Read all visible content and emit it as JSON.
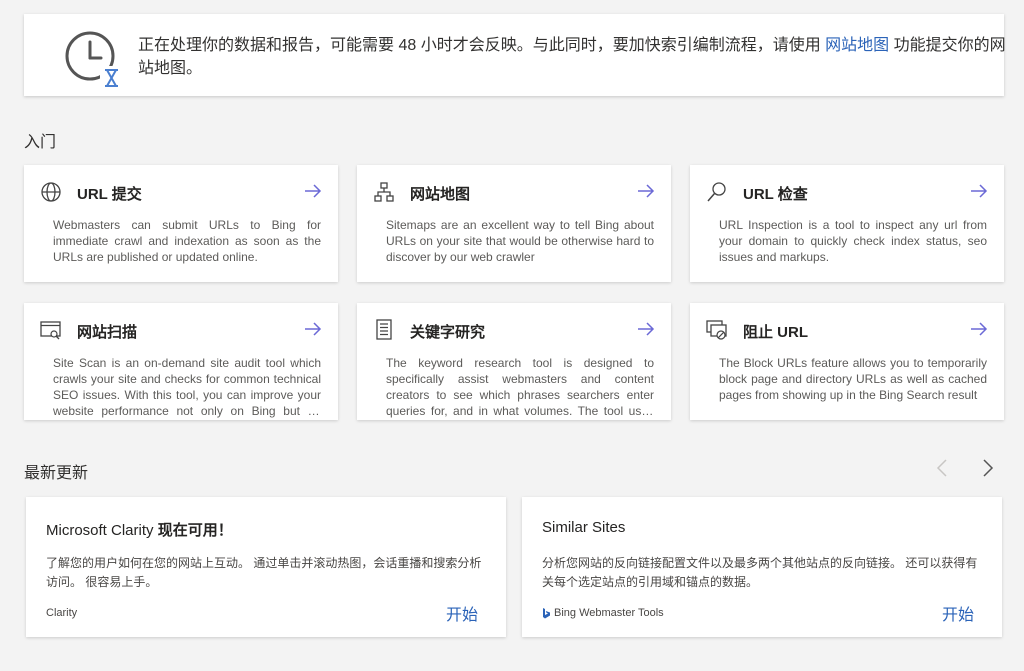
{
  "banner": {
    "text_before": "正在处理你的数据和报告，可能需要 48 小时才会反映。与此同时，要加快索引编制流程，请使用 ",
    "link": "网站地图",
    "text_after": " 功能提交你的网站地图。",
    "icon": "clock-hourglass-icon"
  },
  "getting_started": {
    "title": "入门",
    "cards": [
      {
        "title": "URL 提交",
        "icon": "globe-icon",
        "desc": "Webmasters can submit URLs to Bing for immediate crawl and indexation as soon as the URLs are published or updated online."
      },
      {
        "title": "网站地图",
        "icon": "sitemap-icon",
        "desc": "Sitemaps are an excellent way to tell Bing about URLs on your site that would be otherwise hard to discover by our web crawler"
      },
      {
        "title": "URL 检查",
        "icon": "search-icon",
        "desc": "URL Inspection is a tool to inspect any url from your domain to quickly check index status, seo issues and markups."
      },
      {
        "title": "网站扫描",
        "icon": "site-scan-icon",
        "desc": "Site Scan is an on-demand site audit tool which crawls your site and checks for common technical SEO issues. With this tool, you can improve your website performance not only on Bing but on other search engines too."
      },
      {
        "title": "关键字研究",
        "icon": "document-list-icon",
        "desc": "The keyword research tool is designed to specifically assist webmasters and content creators to see which phrases searchers enter queries for, and in what volumes. The tool uses Bing data."
      },
      {
        "title": "阻止 URL",
        "icon": "block-url-icon",
        "desc": "The Block URLs feature allows you to temporarily block page and directory URLs as well as cached pages from showing up in the Bing Search result"
      }
    ]
  },
  "updates": {
    "title": "最新更新",
    "items": [
      {
        "title_plain": "Microsoft Clarity ",
        "title_bold": "现在可用！",
        "desc": "了解您的用户如何在您的网站上互动。 通过单击并滚动热图，会话重播和搜索分析访问。 很容易上手。",
        "source": "Clarity",
        "button": "开始"
      },
      {
        "title_plain": "Similar Sites",
        "title_bold": "",
        "desc": "分析您网站的反向链接配置文件以及最多两个其他站点的反向链接。 还可以获得有关每个选定站点的引用域和锚点的数据。",
        "source": "Bing Webmaster Tools",
        "button": "开始"
      }
    ]
  },
  "colors": {
    "accent": "#2b63b8",
    "arrow": "#6b69d6",
    "bing": "#2b63b8"
  }
}
